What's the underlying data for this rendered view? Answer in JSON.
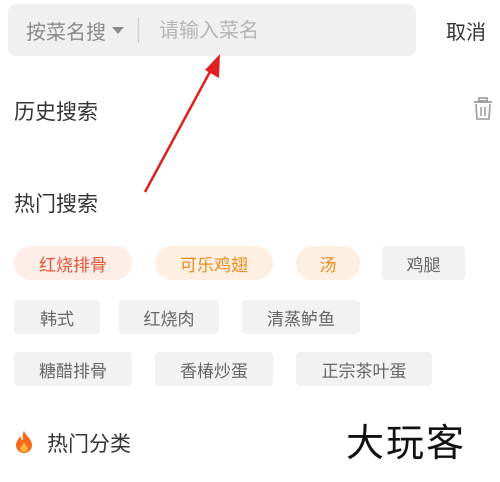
{
  "search": {
    "mode_label": "按菜名搜",
    "placeholder": "请输入菜名",
    "value": ""
  },
  "cancel_label": "取消",
  "history": {
    "title": "历史搜索"
  },
  "hot_search": {
    "title": "热门搜索",
    "tags": [
      {
        "label": "红烧排骨",
        "style": "hot"
      },
      {
        "label": "可乐鸡翅",
        "style": "warm"
      },
      {
        "label": "汤",
        "style": "warm"
      },
      {
        "label": "鸡腿",
        "style": "plain"
      },
      {
        "label": "韩式",
        "style": "plain"
      },
      {
        "label": "红烧肉",
        "style": "plain"
      },
      {
        "label": "清蒸鲈鱼",
        "style": "plain"
      },
      {
        "label": "糖醋排骨",
        "style": "plain"
      },
      {
        "label": "香椿炒蛋",
        "style": "plain"
      },
      {
        "label": "正宗茶叶蛋",
        "style": "plain"
      }
    ]
  },
  "hot_category": {
    "title": "热门分类",
    "icon": "flame-icon"
  },
  "watermark": "大玩客",
  "colors": {
    "hot_tag_text": "#e6553a",
    "warm_tag_text": "#f08a1c",
    "annotation_arrow": "#e02020"
  }
}
